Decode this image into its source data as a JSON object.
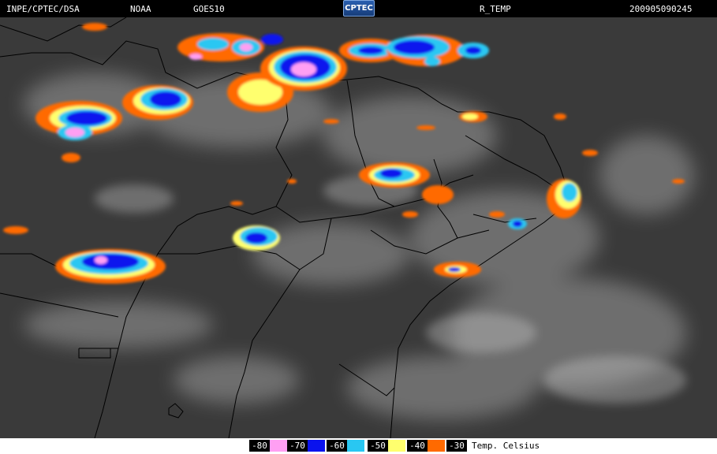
{
  "header": {
    "institution": "INPE/CPTEC/DSA",
    "agency": "NOAA",
    "satellite": "GOES10",
    "logo_text": "CPTEC",
    "product": "R_TEMP",
    "timestamp": "200905090245"
  },
  "legend": {
    "items": [
      {
        "value": "-80",
        "color": "#ff9ff3"
      },
      {
        "value": "-70",
        "color": "#0a12ee"
      },
      {
        "value": "-60",
        "color": "#29c7f2"
      },
      {
        "value": "-50",
        "color": "#ffff6e"
      },
      {
        "value": "-40",
        "color": "#ff6a00"
      },
      {
        "value": "-30",
        "color": ""
      }
    ],
    "unit_label": "Temp. Celsius"
  },
  "colors": {
    "background": "#3a3a3a",
    "cloud": "#bdbdbd",
    "border_line": "#000000"
  }
}
